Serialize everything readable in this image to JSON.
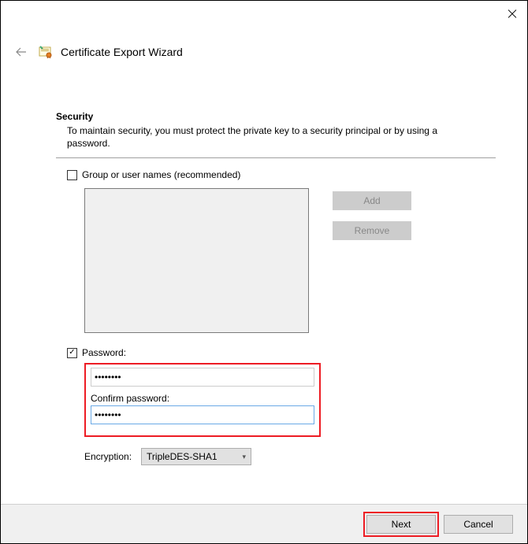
{
  "header": {
    "title": "Certificate Export Wizard"
  },
  "section": {
    "heading": "Security",
    "description": "To maintain security, you must protect the private key to a security principal or by using a password."
  },
  "group": {
    "checkbox_label": "Group or user names (recommended)",
    "add_btn": "Add",
    "remove_btn": "Remove"
  },
  "password": {
    "checkbox_label": "Password:",
    "value": "••••••••",
    "confirm_label": "Confirm password:",
    "confirm_value": "••••••••"
  },
  "encryption": {
    "label": "Encryption:",
    "value": "TripleDES-SHA1"
  },
  "footer": {
    "next": "Next",
    "cancel": "Cancel"
  }
}
